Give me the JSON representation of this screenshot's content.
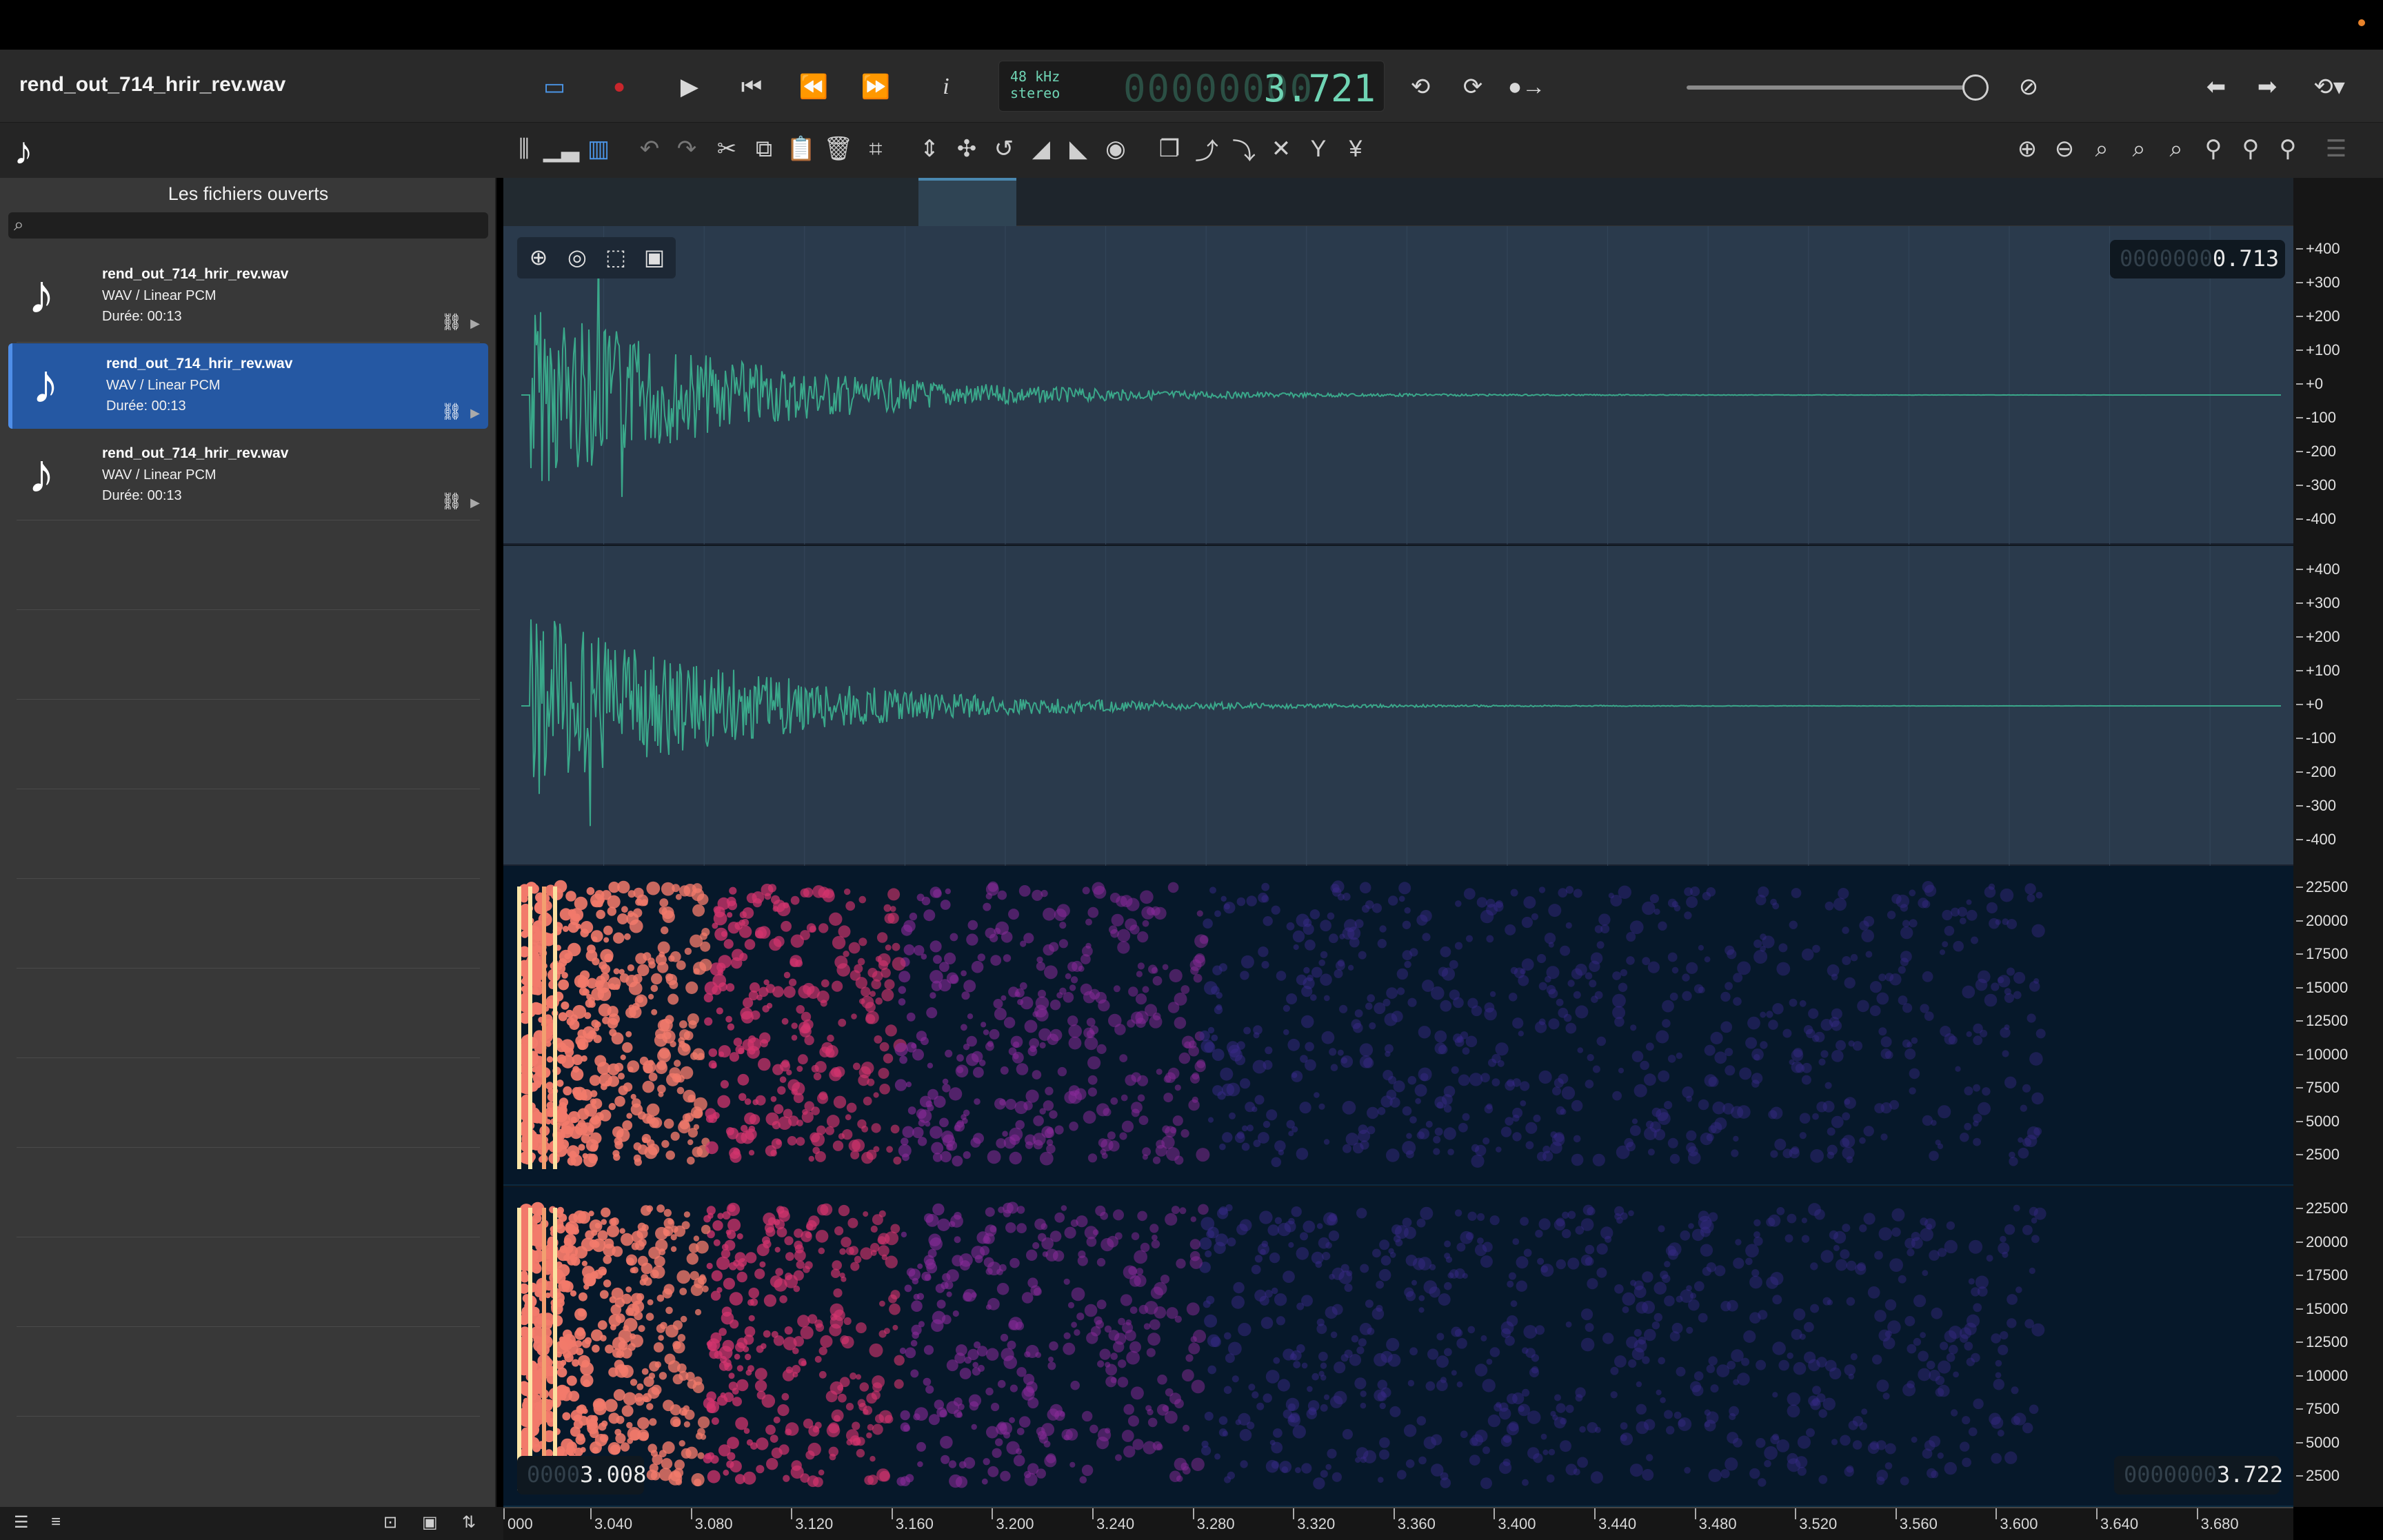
{
  "window": {
    "title": "rend_out_714_hrir_rev.wav"
  },
  "display": {
    "rate": "48 kHz",
    "channels": "stereo",
    "ghost": "00000000",
    "time": "3.721"
  },
  "sidebar": {
    "title": "Les fichiers ouverts",
    "search_placeholder": "",
    "files": [
      {
        "name": "rend_out_714_hrir_rev.wav",
        "format": "WAV / Linear PCM",
        "duration": "Durée: 00:13",
        "selected": false
      },
      {
        "name": "rend_out_714_hrir_rev.wav",
        "format": "WAV / Linear PCM",
        "duration": "Durée: 00:13",
        "selected": true
      },
      {
        "name": "rend_out_714_hrir_rev.wav",
        "format": "WAV / Linear PCM",
        "duration": "Durée: 00:13",
        "selected": false
      }
    ]
  },
  "editor": {
    "top_value_ghost": "0000000",
    "top_value": "0.713",
    "sel_start_ghost": "0000",
    "sel_start": "3.008",
    "sel_end_ghost": "0000000",
    "sel_end": "3.722"
  },
  "ruler": {
    "amp_labels": [
      "+400",
      "+300",
      "+200",
      "+100",
      "+0",
      "-100",
      "-200",
      "-300",
      "-400"
    ],
    "freq_labels": [
      "22500",
      "20000",
      "17500",
      "15000",
      "12500",
      "10000",
      "7500",
      "5000",
      "2500"
    ]
  },
  "timeline": {
    "labels": [
      "000",
      "3.040",
      "3.080",
      "3.120",
      "3.160",
      "3.200",
      "3.240",
      "3.280",
      "3.320",
      "3.360",
      "3.400",
      "3.440",
      "3.480",
      "3.520",
      "3.560",
      "3.600",
      "3.640",
      "3.680"
    ]
  },
  "icons": {
    "toolbar1": [
      "sidebar-toggle-icon",
      "record-icon",
      "play-icon",
      "skip-start-icon",
      "rewind-icon",
      "fast-forward-icon",
      "info-icon",
      "loop-icon",
      "loop-selection-icon",
      "cue-icon",
      "mute-icon",
      "back-arrow-icon",
      "forward-arrow-icon",
      "history-icon"
    ],
    "toolbar2": [
      "waveform-view-icon",
      "spectrum-view-icon",
      "spectrogram-view-icon",
      "undo-icon",
      "redo-icon",
      "cut-icon",
      "copy-icon",
      "paste-icon",
      "delete-icon",
      "crop-icon",
      "normalize-icon",
      "insert-silence-icon",
      "reverse-icon",
      "fade-in-icon",
      "fade-out-icon",
      "effects-icon",
      "duplicate-icon",
      "curve-left-icon",
      "curve-right-icon",
      "swap-channels-icon",
      "merge-icon",
      "split-icon",
      "zoom-in-icon",
      "zoom-out-icon",
      "zoom-fit-icon",
      "zoom-selection-icon",
      "zoom-reset-icon",
      "tool1-icon",
      "tool2-icon",
      "tool3-icon"
    ]
  },
  "colors": {
    "accent": "#2558a3",
    "display": "#6fd4b4",
    "wave": "#3aa88a"
  }
}
